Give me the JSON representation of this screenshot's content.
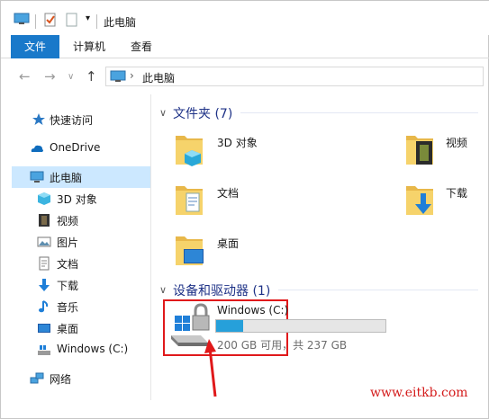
{
  "window": {
    "title": "此电脑"
  },
  "ribbon": {
    "tabs": [
      "文件",
      "计算机",
      "查看"
    ]
  },
  "address": {
    "path": "此电脑"
  },
  "nav": {
    "items": [
      {
        "label": "快速访问",
        "icon": "quick-access-star-icon"
      },
      {
        "label": "OneDrive",
        "icon": "onedrive-cloud-icon"
      },
      {
        "label": "此电脑",
        "icon": "this-pc-icon",
        "selected": true
      },
      {
        "label": "3D 对象",
        "icon": "3d-objects-icon"
      },
      {
        "label": "视频",
        "icon": "videos-icon"
      },
      {
        "label": "图片",
        "icon": "pictures-icon"
      },
      {
        "label": "文档",
        "icon": "documents-icon"
      },
      {
        "label": "下载",
        "icon": "downloads-icon"
      },
      {
        "label": "音乐",
        "icon": "music-icon"
      },
      {
        "label": "桌面",
        "icon": "desktop-icon"
      },
      {
        "label": "Windows (C:)",
        "icon": "drive-c-icon"
      },
      {
        "label": "网络",
        "icon": "network-icon"
      }
    ]
  },
  "folders_group": {
    "header": "文件夹 (7)",
    "items": [
      {
        "label": "3D 对象",
        "icon": "3d-objects-folder-icon"
      },
      {
        "label": "视频",
        "icon": "videos-folder-icon"
      },
      {
        "label": "文档",
        "icon": "documents-folder-icon"
      },
      {
        "label": "下载",
        "icon": "downloads-folder-icon"
      },
      {
        "label": "桌面",
        "icon": "desktop-folder-icon"
      }
    ]
  },
  "drives_group": {
    "header": "设备和驱动器 (1)",
    "drive": {
      "name": "Windows (C:)",
      "free_text": "200 GB 可用，共 237 GB",
      "used_fraction": 0.16
    }
  },
  "colors": {
    "accent": "#1979ca",
    "selected_bg": "#cce8ff",
    "highlight": "#e0191b",
    "bar_fill": "#26a0da"
  },
  "watermark": "www.eitkb.com"
}
